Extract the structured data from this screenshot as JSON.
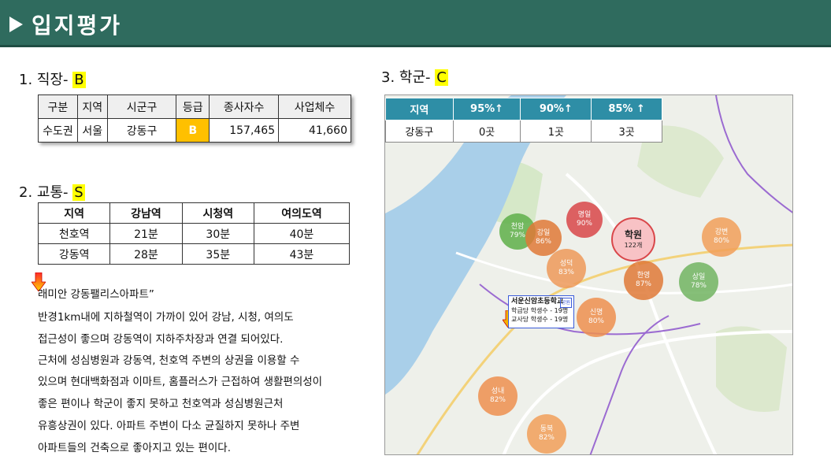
{
  "header": {
    "title": "입지평가"
  },
  "section1": {
    "label": "1.   직장- ",
    "grade": "B",
    "columns": [
      "구분",
      "지역",
      "시군구",
      "등급",
      "종사자수",
      "사업체수"
    ],
    "row": {
      "area": "수도권",
      "region": "서울",
      "district": "강동구",
      "grade": "B",
      "workers": "157,465",
      "businesses": "41,660"
    }
  },
  "section2": {
    "label": "2.   교통-  ",
    "grade": "S",
    "columns": [
      "지역",
      "강남역",
      "시청역",
      "여의도역"
    ],
    "rows": [
      [
        "천호역",
        "21분",
        "30분",
        "40분"
      ],
      [
        "강동역",
        "28분",
        "35분",
        "43분"
      ]
    ]
  },
  "description": {
    "lines": [
      "래미안 강동팰리스아파트”",
      "반경1km내에 지하철역이 가까이 있어 강남, 시청, 여의도",
      "접근성이 좋으며 강동역이 지하주차장과 연결 되어있다.",
      "근처에 성심병원과 강동역, 천호역 주변의 상권을 이용할 수",
      "있으며 현대백화점과 이마트, 홈플러스가 근접하여 생활편의성이",
      "좋은 편이나 학군이 좋지 못하고 천호역과 성심병원근처",
      "유흥상권이 있다.  아파트 주변이 다소 균질하지 못하나 주변",
      "아파트들의 건축으로 좋아지고 있는 편이다."
    ]
  },
  "section3": {
    "label": "3. 학군- ",
    "grade": "C",
    "columns": [
      "지역",
      "95%↑",
      "90%↑",
      "85% ↑"
    ],
    "row": [
      "강동구",
      "0곳",
      "1곳",
      "3곳"
    ]
  },
  "map": {
    "callout": {
      "name": "서운신암초등학교",
      "tag": "공원",
      "line1": "학급당 학생수 - 19명",
      "line2": "교사당 학생수 - 19명"
    },
    "bubbles": [
      {
        "name": "천암",
        "pct": "79%",
        "color": "#5fb04a"
      },
      {
        "name": "강일",
        "pct": "86%",
        "color": "#e07a38"
      },
      {
        "name": "명일",
        "pct": "90%",
        "color": "#d9474a"
      },
      {
        "name": "학원",
        "pct": "122개",
        "color": "#f4a8ac"
      },
      {
        "name": "강변",
        "pct": "80%",
        "color": "#f2a05a"
      },
      {
        "name": "성덕",
        "pct": "83%",
        "color": "#ee9a5a"
      },
      {
        "name": "한영",
        "pct": "87%",
        "color": "#e07a38"
      },
      {
        "name": "상일",
        "pct": "78%",
        "color": "#72b562"
      },
      {
        "name": "신명",
        "pct": "80%",
        "color": "#ee9050"
      },
      {
        "name": "성내",
        "pct": "82%",
        "color": "#ee9050"
      },
      {
        "name": "동북",
        "pct": "82%",
        "color": "#f2a05a"
      }
    ]
  }
}
